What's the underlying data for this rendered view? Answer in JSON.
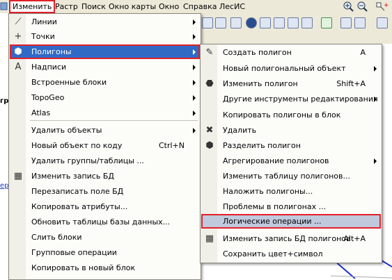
{
  "menubar": {
    "items": [
      "Изменить",
      "Растр",
      "Поиск",
      "Окно карты",
      "Окно",
      "Справка",
      "ЛесИС"
    ],
    "active_index": 0
  },
  "main_menu": {
    "items": [
      {
        "label": "Линии",
        "icon": "polyline-icon",
        "glyph": "⟋",
        "submenu": true
      },
      {
        "label": "Точки",
        "icon": "plus-point-icon",
        "glyph": "+",
        "submenu": true
      },
      {
        "label": "Полигоны",
        "icon": "polygon-icon",
        "glyph": "⬢",
        "submenu": true,
        "highlighted": true
      },
      {
        "label": "Надписи",
        "icon": "text-a-icon",
        "glyph": "A",
        "submenu": true
      },
      {
        "label": "Встроенные блоки",
        "submenu": true
      },
      {
        "label": "TopoGeo",
        "submenu": true
      },
      {
        "label": "Atlas",
        "submenu": true
      },
      {
        "label": "Удалить объекты",
        "submenu": true,
        "separator_before": true
      },
      {
        "label": "Новый объект по коду",
        "shortcut": "Ctrl+N"
      },
      {
        "label": "Удалить группы/таблицы ..."
      },
      {
        "label": "Изменить запись БД",
        "icon": "db-record-icon",
        "glyph": "▦"
      },
      {
        "label": "Перезаписать поле БД"
      },
      {
        "label": "Копировать атрибуты..."
      },
      {
        "label": "Обновить таблицы базы данных..."
      },
      {
        "label": "Слить блоки"
      },
      {
        "label": "Групповые операции"
      },
      {
        "label": "Копировать в новый блок"
      }
    ]
  },
  "sub_menu": {
    "items": [
      {
        "label": "Создать полигон",
        "shortcut": "A",
        "icon": "create-polygon-icon",
        "glyph": "✎"
      },
      {
        "label": "Новый полигональный объект",
        "submenu": true
      },
      {
        "label": "Изменить полигон",
        "shortcut": "Shift+A",
        "icon": "edit-polygon-icon",
        "glyph": "⬣"
      },
      {
        "label": "Другие инструменты редактирования",
        "submenu": true
      },
      {
        "label": "Копировать полигоны в блок"
      },
      {
        "label": "Удалить",
        "icon": "delete-polygon-icon",
        "glyph": "✖"
      },
      {
        "label": "Разделить полигон",
        "icon": "split-polygon-icon",
        "glyph": "⬢"
      },
      {
        "label": "Агрегирование полигонов",
        "submenu": true
      },
      {
        "label": "Изменить таблицу полигонов..."
      },
      {
        "label": "Наложить полигоны..."
      },
      {
        "label": "Проблемы в полигонах ..."
      },
      {
        "label": "Логические операции ...",
        "selected_box": true
      },
      {
        "label": "Изменить запись БД полигонов",
        "shortcut": "Alt+A",
        "icon": "db-record-icon",
        "glyph": "▦"
      },
      {
        "label": "Сохранить цвет+символ"
      }
    ]
  },
  "background": {
    "left_label": "гр",
    "left_link": "ер"
  },
  "colors": {
    "highlight": "#316ac5",
    "annotation_red": "#e0202a",
    "selected_box_fill": "#c1c9dd"
  }
}
